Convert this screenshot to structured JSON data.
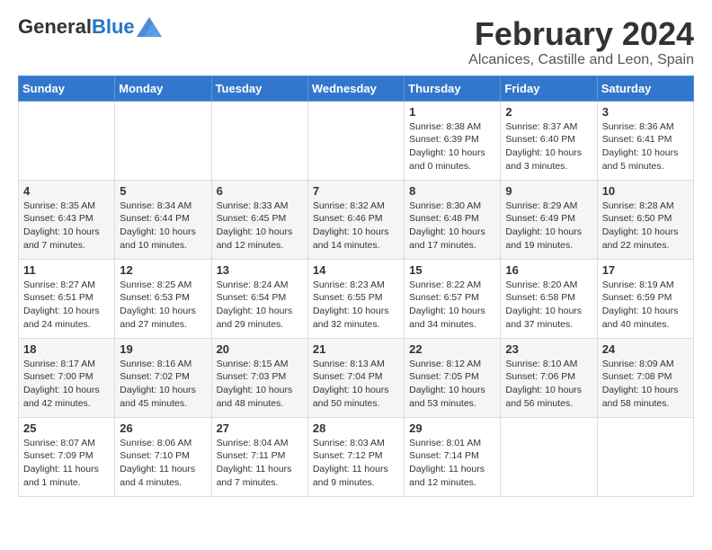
{
  "header": {
    "logo_general": "General",
    "logo_blue": "Blue",
    "main_title": "February 2024",
    "subtitle": "Alcanices, Castille and Leon, Spain"
  },
  "days_of_week": [
    "Sunday",
    "Monday",
    "Tuesday",
    "Wednesday",
    "Thursday",
    "Friday",
    "Saturday"
  ],
  "weeks": [
    [
      {
        "day": "",
        "text": ""
      },
      {
        "day": "",
        "text": ""
      },
      {
        "day": "",
        "text": ""
      },
      {
        "day": "",
        "text": ""
      },
      {
        "day": "1",
        "text": "Sunrise: 8:38 AM\nSunset: 6:39 PM\nDaylight: 10 hours\nand 0 minutes."
      },
      {
        "day": "2",
        "text": "Sunrise: 8:37 AM\nSunset: 6:40 PM\nDaylight: 10 hours\nand 3 minutes."
      },
      {
        "day": "3",
        "text": "Sunrise: 8:36 AM\nSunset: 6:41 PM\nDaylight: 10 hours\nand 5 minutes."
      }
    ],
    [
      {
        "day": "4",
        "text": "Sunrise: 8:35 AM\nSunset: 6:43 PM\nDaylight: 10 hours\nand 7 minutes."
      },
      {
        "day": "5",
        "text": "Sunrise: 8:34 AM\nSunset: 6:44 PM\nDaylight: 10 hours\nand 10 minutes."
      },
      {
        "day": "6",
        "text": "Sunrise: 8:33 AM\nSunset: 6:45 PM\nDaylight: 10 hours\nand 12 minutes."
      },
      {
        "day": "7",
        "text": "Sunrise: 8:32 AM\nSunset: 6:46 PM\nDaylight: 10 hours\nand 14 minutes."
      },
      {
        "day": "8",
        "text": "Sunrise: 8:30 AM\nSunset: 6:48 PM\nDaylight: 10 hours\nand 17 minutes."
      },
      {
        "day": "9",
        "text": "Sunrise: 8:29 AM\nSunset: 6:49 PM\nDaylight: 10 hours\nand 19 minutes."
      },
      {
        "day": "10",
        "text": "Sunrise: 8:28 AM\nSunset: 6:50 PM\nDaylight: 10 hours\nand 22 minutes."
      }
    ],
    [
      {
        "day": "11",
        "text": "Sunrise: 8:27 AM\nSunset: 6:51 PM\nDaylight: 10 hours\nand 24 minutes."
      },
      {
        "day": "12",
        "text": "Sunrise: 8:25 AM\nSunset: 6:53 PM\nDaylight: 10 hours\nand 27 minutes."
      },
      {
        "day": "13",
        "text": "Sunrise: 8:24 AM\nSunset: 6:54 PM\nDaylight: 10 hours\nand 29 minutes."
      },
      {
        "day": "14",
        "text": "Sunrise: 8:23 AM\nSunset: 6:55 PM\nDaylight: 10 hours\nand 32 minutes."
      },
      {
        "day": "15",
        "text": "Sunrise: 8:22 AM\nSunset: 6:57 PM\nDaylight: 10 hours\nand 34 minutes."
      },
      {
        "day": "16",
        "text": "Sunrise: 8:20 AM\nSunset: 6:58 PM\nDaylight: 10 hours\nand 37 minutes."
      },
      {
        "day": "17",
        "text": "Sunrise: 8:19 AM\nSunset: 6:59 PM\nDaylight: 10 hours\nand 40 minutes."
      }
    ],
    [
      {
        "day": "18",
        "text": "Sunrise: 8:17 AM\nSunset: 7:00 PM\nDaylight: 10 hours\nand 42 minutes."
      },
      {
        "day": "19",
        "text": "Sunrise: 8:16 AM\nSunset: 7:02 PM\nDaylight: 10 hours\nand 45 minutes."
      },
      {
        "day": "20",
        "text": "Sunrise: 8:15 AM\nSunset: 7:03 PM\nDaylight: 10 hours\nand 48 minutes."
      },
      {
        "day": "21",
        "text": "Sunrise: 8:13 AM\nSunset: 7:04 PM\nDaylight: 10 hours\nand 50 minutes."
      },
      {
        "day": "22",
        "text": "Sunrise: 8:12 AM\nSunset: 7:05 PM\nDaylight: 10 hours\nand 53 minutes."
      },
      {
        "day": "23",
        "text": "Sunrise: 8:10 AM\nSunset: 7:06 PM\nDaylight: 10 hours\nand 56 minutes."
      },
      {
        "day": "24",
        "text": "Sunrise: 8:09 AM\nSunset: 7:08 PM\nDaylight: 10 hours\nand 58 minutes."
      }
    ],
    [
      {
        "day": "25",
        "text": "Sunrise: 8:07 AM\nSunset: 7:09 PM\nDaylight: 11 hours\nand 1 minute."
      },
      {
        "day": "26",
        "text": "Sunrise: 8:06 AM\nSunset: 7:10 PM\nDaylight: 11 hours\nand 4 minutes."
      },
      {
        "day": "27",
        "text": "Sunrise: 8:04 AM\nSunset: 7:11 PM\nDaylight: 11 hours\nand 7 minutes."
      },
      {
        "day": "28",
        "text": "Sunrise: 8:03 AM\nSunset: 7:12 PM\nDaylight: 11 hours\nand 9 minutes."
      },
      {
        "day": "29",
        "text": "Sunrise: 8:01 AM\nSunset: 7:14 PM\nDaylight: 11 hours\nand 12 minutes."
      },
      {
        "day": "",
        "text": ""
      },
      {
        "day": "",
        "text": ""
      }
    ]
  ]
}
